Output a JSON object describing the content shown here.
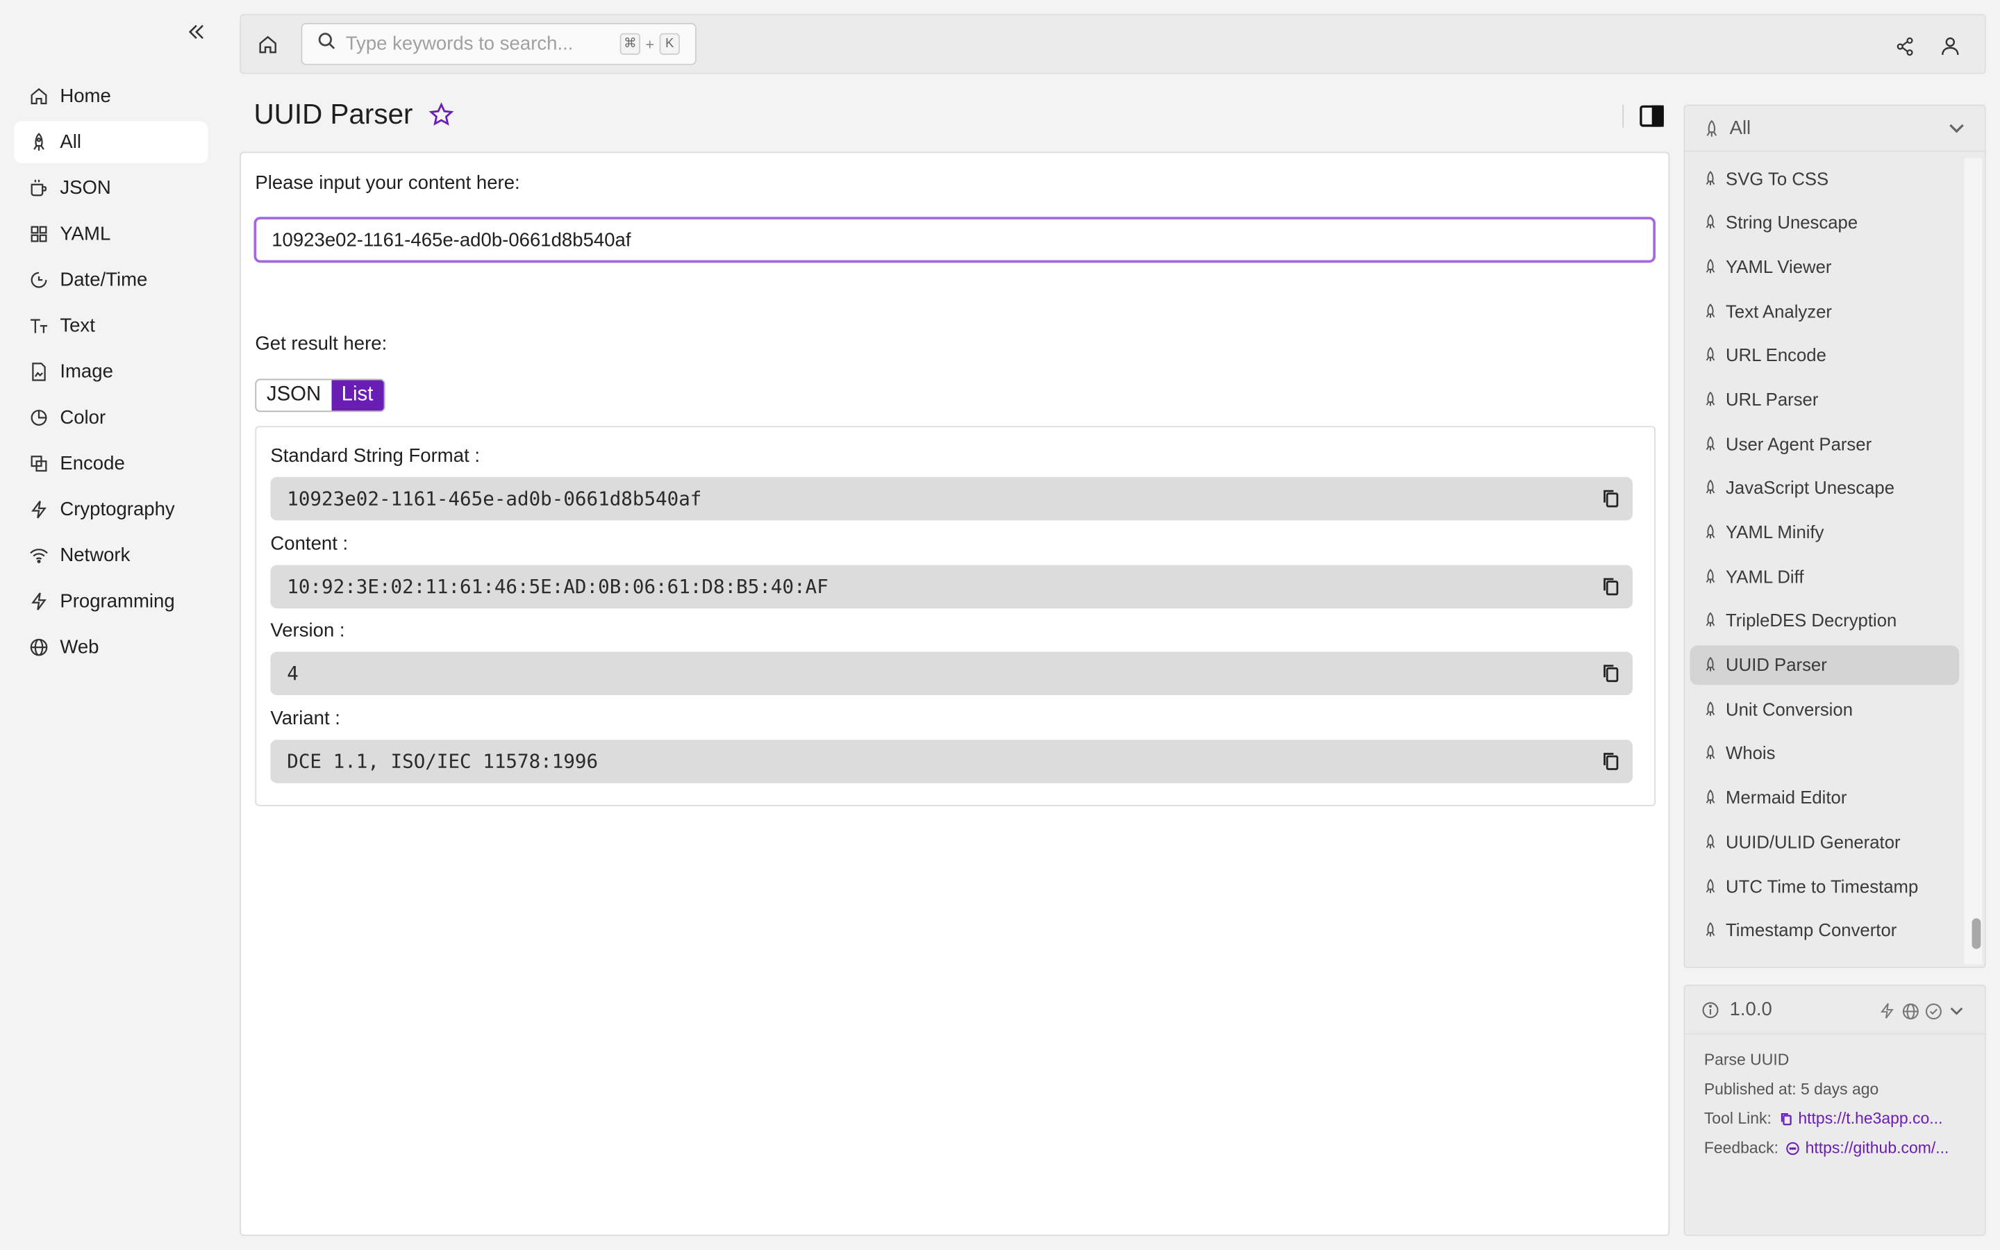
{
  "sidebar": {
    "items": [
      {
        "label": "Home",
        "icon": "home-icon"
      },
      {
        "label": "All",
        "icon": "rocket-icon",
        "active": true
      },
      {
        "label": "JSON",
        "icon": "mug-icon"
      },
      {
        "label": "YAML",
        "icon": "grid-icon"
      },
      {
        "label": "Date/Time",
        "icon": "clock-icon"
      },
      {
        "label": "Text",
        "icon": "text-icon"
      },
      {
        "label": "Image",
        "icon": "image-file-icon"
      },
      {
        "label": "Color",
        "icon": "pie-icon"
      },
      {
        "label": "Encode",
        "icon": "encode-icon"
      },
      {
        "label": "Cryptography",
        "icon": "bolt-icon"
      },
      {
        "label": "Network",
        "icon": "wifi-icon"
      },
      {
        "label": "Programming",
        "icon": "bolt-icon"
      },
      {
        "label": "Web",
        "icon": "globe-icon"
      }
    ]
  },
  "topbar": {
    "search_placeholder": "Type keywords to search...",
    "shortcut_mod": "⌘",
    "shortcut_plus": "+",
    "shortcut_key": "K"
  },
  "main": {
    "title": "UUID Parser",
    "input_label": "Please input your content here:",
    "input_value": "10923e02-1161-465e-ad0b-0661d8b540af",
    "result_label": "Get result here:",
    "tabs": [
      {
        "label": "JSON",
        "active": false
      },
      {
        "label": "List",
        "active": true
      }
    ],
    "fields": [
      {
        "label": "Standard String Format :",
        "value": "10923e02-1161-465e-ad0b-0661d8b540af"
      },
      {
        "label": "Content :",
        "value": "10:92:3E:02:11:61:46:5E:AD:0B:06:61:D8:B5:40:AF"
      },
      {
        "label": "Version :",
        "value": "4"
      },
      {
        "label": "Variant :",
        "value": "DCE 1.1, ISO/IEC 11578:1996"
      }
    ]
  },
  "right_panel": {
    "filter_label": "All",
    "tools": [
      "SVG To CSS",
      "String Unescape",
      "YAML Viewer",
      "Text Analyzer",
      "URL Encode",
      "URL Parser",
      "User Agent Parser",
      "JavaScript Unescape",
      "YAML Minify",
      "YAML Diff",
      "TripleDES Decryption",
      "UUID Parser",
      "Unit Conversion",
      "Whois",
      "Mermaid Editor",
      "UUID/ULID Generator",
      "UTC Time to Timestamp",
      "Timestamp Convertor"
    ],
    "active_tool": "UUID Parser"
  },
  "info": {
    "version": "1.0.0",
    "description": "Parse UUID",
    "published": "Published at: 5 days ago",
    "tool_link_label": "Tool Link:",
    "tool_link": "https://t.he3app.co...",
    "feedback_label": "Feedback:",
    "feedback_link": "https://github.com/..."
  },
  "colors": {
    "accent": "#6a1db5",
    "input_border": "#a268e0",
    "field_bg": "#dcdcdc"
  }
}
